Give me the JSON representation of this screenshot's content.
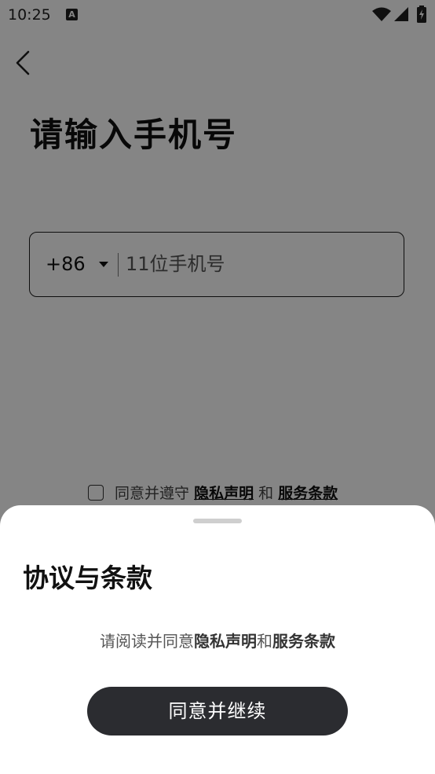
{
  "status_bar": {
    "time": "10:25",
    "notification_icon": "a-letter-icon",
    "notification_glyph": "A",
    "icons": [
      "wifi-icon",
      "signal-icon",
      "battery-charging-icon"
    ]
  },
  "page": {
    "back_icon": "chevron-left-icon",
    "title": "请输入手机号",
    "phone_field": {
      "country_code": "+86",
      "dropdown_icon": "caret-down-icon",
      "placeholder": "11位手机号",
      "value": ""
    },
    "agreement": {
      "prefix": "同意并遵守",
      "privacy_link": "隐私声明",
      "conjunction": "和",
      "terms_link": "服务条款",
      "checked": false
    }
  },
  "sheet": {
    "title": "协议与条款",
    "desc_prefix": "请阅读并同意",
    "privacy": "隐私声明",
    "conjunction": "和",
    "terms": "服务条款",
    "button_label": "同意并继续"
  },
  "colors": {
    "overlay": "rgba(0,0,0,0.48)",
    "primary_button": "#2b2c30",
    "sheet_bg": "#ffffff"
  }
}
